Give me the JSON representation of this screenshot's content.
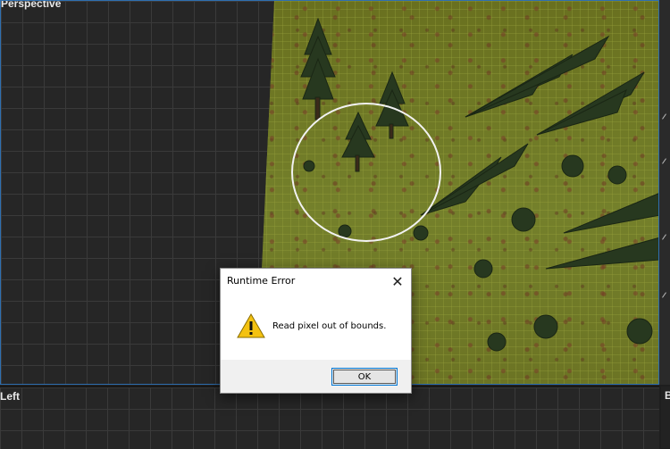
{
  "viewports": {
    "top_label": "Perspective",
    "bottom_left_label": "Left",
    "bottom_right_label": "B"
  },
  "dialog": {
    "title": "Runtime Error",
    "close_symbol": "✕",
    "message": "Read pixel out of bounds.",
    "ok_label": "OK",
    "icon": "warning-icon"
  },
  "colors": {
    "viewport_border": "#2f6fb0",
    "terrain": "#6b7226",
    "warning_yellow": "#f4c211"
  }
}
